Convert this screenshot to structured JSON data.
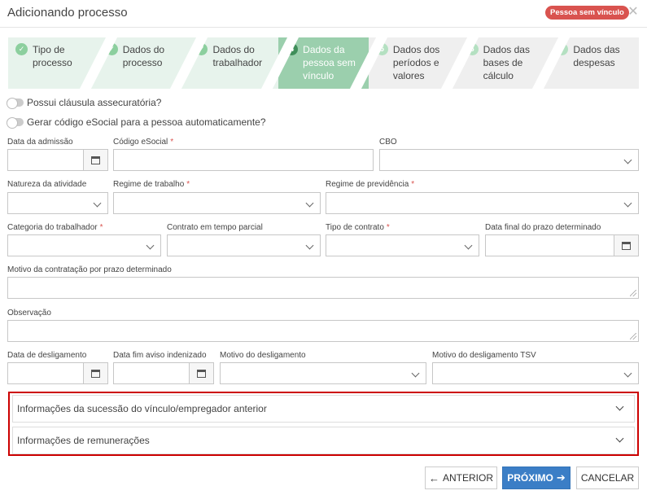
{
  "header": {
    "title": "Adicionando processo",
    "badge": "Pessoa sem vínculo"
  },
  "steps": [
    {
      "num": "1",
      "line1": "Tipo de",
      "line2": "processo",
      "line3": "",
      "state": "done"
    },
    {
      "num": "2",
      "line1": "Dados do",
      "line2": "processo",
      "line3": "",
      "state": "done"
    },
    {
      "num": "3",
      "line1": "Dados do",
      "line2": "trabalhador",
      "line3": "",
      "state": "done"
    },
    {
      "num": "4",
      "line1": "Dados da",
      "line2": "pessoa sem",
      "line3": "vínculo",
      "state": "active"
    },
    {
      "num": "5",
      "line1": "Dados dos",
      "line2": "períodos e",
      "line3": "valores",
      "state": "pending"
    },
    {
      "num": "6",
      "line1": "Dados das",
      "line2": "bases de",
      "line3": "cálculo",
      "state": "pending"
    },
    {
      "num": "7",
      "line1": "Dados das",
      "line2": "despesas",
      "line3": "",
      "state": "pending"
    }
  ],
  "toggles": {
    "clausula": "Possui cláusula assecuratória?",
    "esocial": "Gerar código eSocial para a pessoa automaticamente?"
  },
  "fields": {
    "data_admissao": "Data da admissão",
    "codigo_esocial": "Código eSocial",
    "cbo": "CBO",
    "natureza": "Natureza da atividade",
    "regime_trabalho": "Regime de trabalho",
    "regime_previdencia": "Regime de previdência",
    "categoria": "Categoria do trabalhador",
    "contrato_parcial": "Contrato em tempo parcial",
    "tipo_contrato": "Tipo de contrato",
    "data_final_prazo": "Data final do prazo determinado",
    "motivo_contratacao": "Motivo da contratação por prazo determinado",
    "observacao": "Observação",
    "data_desligamento": "Data de desligamento",
    "data_fim_aviso": "Data fim aviso indenizado",
    "motivo_desligamento": "Motivo do desligamento",
    "motivo_desligamento_tsv": "Motivo do desligamento TSV"
  },
  "required_mark": "*",
  "accordions": {
    "sucessao": "Informações da sucessão do vínculo/empregador anterior",
    "remuneracoes": "Informações de remunerações"
  },
  "buttons": {
    "anterior": "ANTERIOR",
    "proximo": "PRÓXIMO",
    "cancelar": "CANCELAR"
  },
  "colors": {
    "badge": "#d9534f",
    "active_step": "#9bcfad",
    "primary": "#3b7ec6",
    "highlight_border": "#cc0000"
  }
}
